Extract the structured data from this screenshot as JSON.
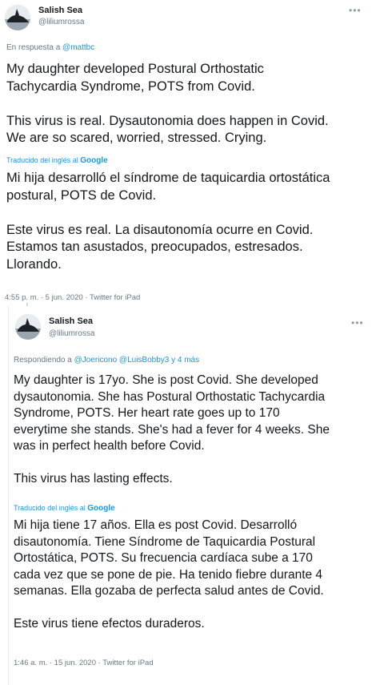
{
  "tweet1": {
    "name": "Salish Sea",
    "handle": "@liliumrossa",
    "more": "•••",
    "reply_prefix": "En respuesta a ",
    "reply_mention": "@mattbc",
    "original": "My daughter developed Postural Orthostatic\nTachycardia Syndrome, POTS from Covid.\n\nThis virus is real. Dysautonomia does happen in Covid.\nWe are so scared, worried, stressed. Crying.",
    "translated_prefix": "Traducido del inglés al ",
    "translated_brand": "Google",
    "translation": "Mi hija desarrolló el síndrome de taquicardia ortostática\npostural, POTS de Covid.\n\n Este virus es real. La disautonomía ocurre en Covid.\nEstamos tan asustados, preocupados, estresados.\nLlorando.",
    "meta": "4:55 p. m. · 5 jun. 2020 · Twitter for iPad"
  },
  "tweet2": {
    "name": "Salish Sea",
    "handle": "@liliumrossa",
    "more": "•••",
    "reply_prefix": "Respondiendo a ",
    "reply_mentions": "@Joericono @LuisBobby3 y 4 más",
    "original": "My daughter is 17yo. She is post Covid. She developed\ndysautonomia. She has Postural Orthostatic Tachycardia\nSyndrome, POTS. Her heart rate goes up to 170\neverytime she stands. She's had a fever for 4 weeks. She\nwas in perfect health before Covid.\n\nThis virus has lasting effects.",
    "translated_prefix": "Traducido del inglés al ",
    "translated_brand": "Google",
    "translation": "Mi hija tiene 17 años. Ella es post Covid. Desarrolló\ndisautonomía. Tiene Síndrome de Taquicardia Postural\nOrtostática, POTS. Su frecuencia cardíaca sube a 170\ncada vez que se pone de pie. Ha tenido fiebre durante 4\nsemanas. Ella gozaba de perfecta salud antes de Covid.\n\n Este virus tiene efectos duraderos.",
    "meta": "1:46 a. m. · 15 jun. 2020 · Twitter for iPad"
  }
}
